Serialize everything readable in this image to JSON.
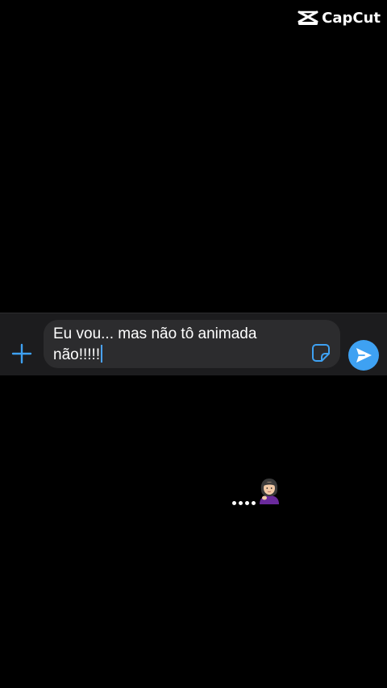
{
  "watermark": {
    "brand": "CapCut",
    "icon": "capcut-logo-icon"
  },
  "composer": {
    "attach_icon": "plus-icon",
    "message_text": "Eu vou... mas não tô animada não!!!!!",
    "sticker_icon": "sticker-icon",
    "send_icon": "send-arrow-icon"
  },
  "typing_indicator": {
    "dots_icon": "typing-dots-icon",
    "avatar_icon": "woman-emoji-avatar-icon"
  },
  "colors": {
    "background": "#000000",
    "composer_bar": "#1c1c1e",
    "field": "#2c2c2e",
    "accent": "#3ea1f2",
    "text": "#ffffff"
  }
}
